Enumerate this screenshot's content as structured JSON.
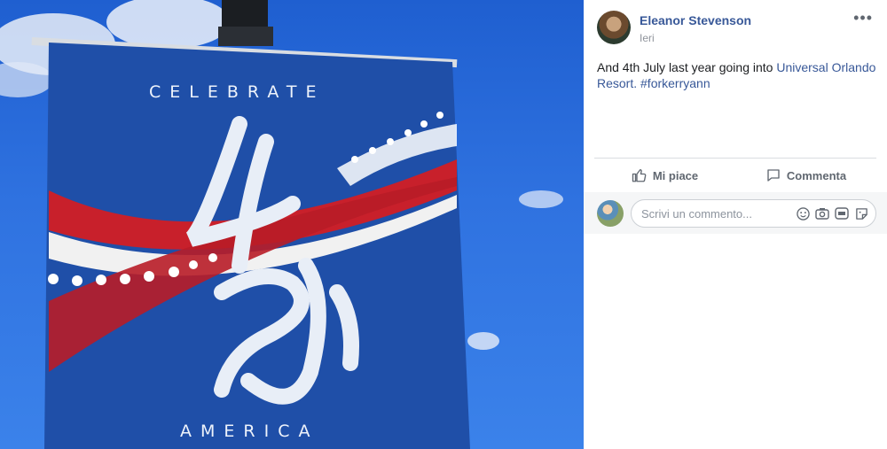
{
  "photo": {
    "banner_top": "CELEBRATE",
    "banner_bottom": "AMERICA",
    "colors": {
      "sky": "#2f72e0",
      "banner": "#1f4fa8",
      "red": "#c8202b",
      "white": "#ffffff"
    }
  },
  "post": {
    "author": "Eleanor Stevenson",
    "time": "Ieri",
    "text_prefix": "And 4th July last year going into ",
    "link_place": "Universal Orlando Resort.",
    "hashtag": "#forkerryann"
  },
  "actions": {
    "like_label": "Mi piace",
    "comment_label": "Commenta"
  },
  "comment": {
    "placeholder": "Scrivi un commento...",
    "icons": [
      "emoji-icon",
      "camera-icon",
      "gif-icon",
      "sticker-icon"
    ]
  },
  "colors": {
    "link": "#385898",
    "muted": "#606770"
  }
}
